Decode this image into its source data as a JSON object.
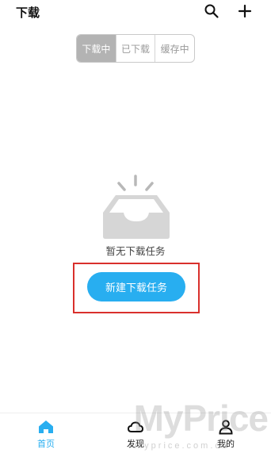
{
  "header": {
    "title": "下载",
    "search_icon": "search-icon",
    "add_icon": "plus-icon"
  },
  "tabs": [
    {
      "label": "下载中",
      "active": true
    },
    {
      "label": "已下载",
      "active": false
    },
    {
      "label": "缓存中",
      "active": false
    }
  ],
  "empty_state": {
    "icon": "empty-inbox-icon",
    "message": "暂无下载任务",
    "button_label": "新建下载任务"
  },
  "bottom_nav": [
    {
      "label": "首页",
      "icon": "home-icon",
      "active": true
    },
    {
      "label": "发现",
      "icon": "cloud-icon",
      "active": false
    },
    {
      "label": "我的",
      "icon": "user-icon",
      "active": false
    }
  ],
  "watermark": {
    "text": "MyPrice",
    "subtext": "myprice.com.cn"
  },
  "colors": {
    "accent": "#28aef0",
    "tab_active_bg": "#b3b3b3",
    "highlight_border": "#d9302c"
  }
}
